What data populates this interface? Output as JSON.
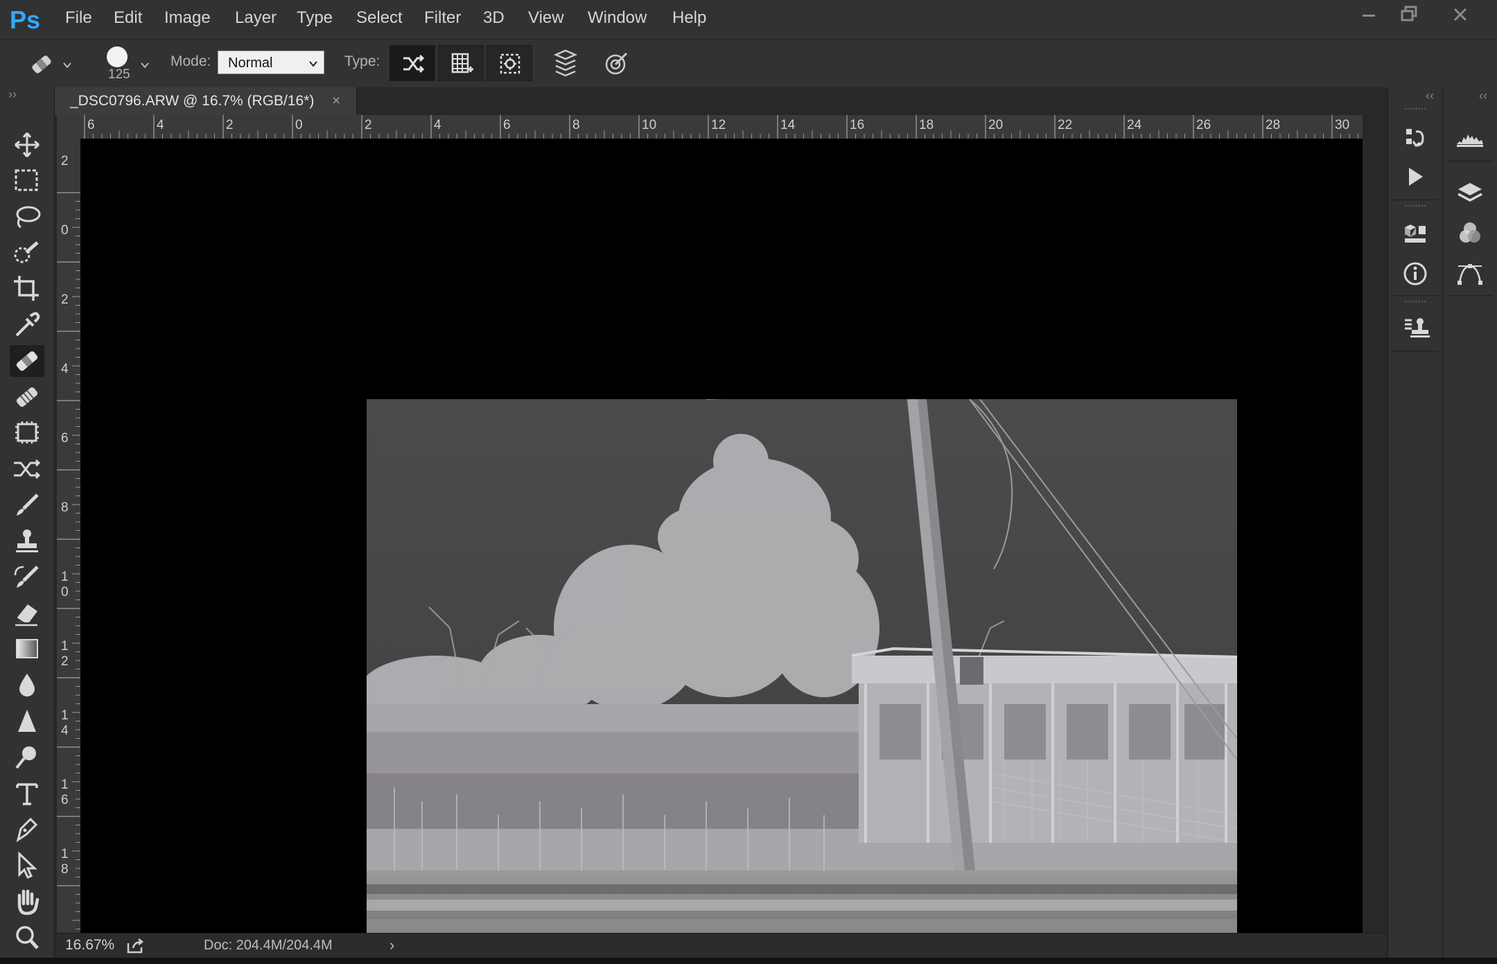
{
  "app": {
    "logo": "Ps",
    "menu": [
      "File",
      "Edit",
      "Image",
      "Layer",
      "Type",
      "Select",
      "Filter",
      "3D",
      "View",
      "Window",
      "Help"
    ]
  },
  "options_bar": {
    "brush_size": "125",
    "mode_label": "Mode:",
    "mode_value": "Normal",
    "type_label": "Type:"
  },
  "document": {
    "tab_title": "_DSC0796.ARW @ 16.7% (RGB/16*)",
    "tab_close": "×"
  },
  "rulers": {
    "top_labels": [
      "6",
      "4",
      "2",
      "0",
      "2",
      "4",
      "6",
      "8",
      "10",
      "12",
      "14",
      "16",
      "18",
      "20",
      "22",
      "24",
      "26",
      "28",
      "30"
    ],
    "left_labels": [
      "2",
      "0",
      "2",
      "4",
      "6",
      "8",
      "10",
      "12",
      "14",
      "16",
      "18"
    ]
  },
  "status": {
    "zoom": "16.67%",
    "doc_size": "Doc: 204.4M/204.4M",
    "arrow": "›"
  },
  "tools": [
    "move-tool",
    "marquee-tool",
    "lasso-tool",
    "quick-selection-tool",
    "crop-tool",
    "eyedropper-tool",
    "spot-healing-brush-tool",
    "healing-brush-tool",
    "patch-tool",
    "content-aware-move-tool",
    "brush-tool",
    "clone-stamp-tool",
    "history-brush-tool",
    "eraser-tool",
    "gradient-tool",
    "blur-tool",
    "sharpen-tool",
    "dodge-tool",
    "type-tool",
    "pen-tool",
    "path-selection-tool",
    "hand-tool",
    "zoom-tool"
  ]
}
